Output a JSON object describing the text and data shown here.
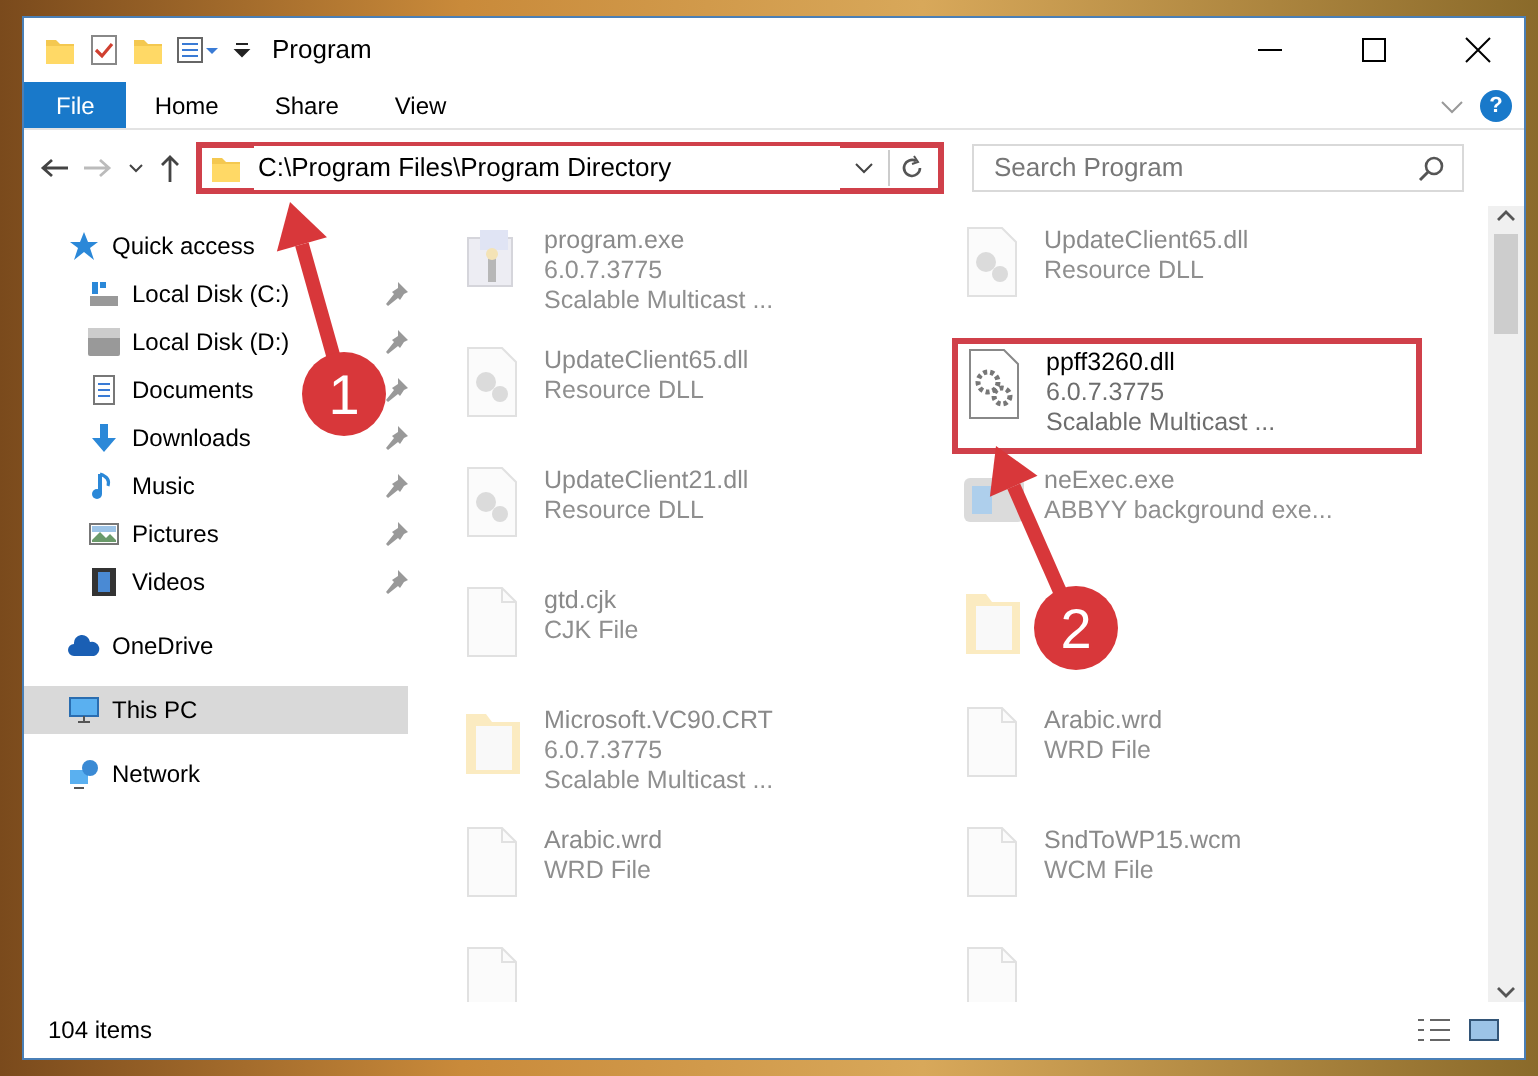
{
  "window": {
    "title": "Program"
  },
  "ribbon_tabs": [
    {
      "label": "File",
      "kind": "file",
      "selected": false
    },
    {
      "label": "Home",
      "kind": "tab",
      "selected": false
    },
    {
      "label": "Share",
      "kind": "tab",
      "selected": false
    },
    {
      "label": "View",
      "kind": "tab",
      "selected": false
    }
  ],
  "help_button": {
    "label": "?"
  },
  "address": {
    "path": "C:\\Program Files\\Program Directory",
    "highlighted": true
  },
  "search": {
    "placeholder": "Search Program"
  },
  "sidebar": [
    {
      "label": "Quick access",
      "kind": "star",
      "selected": false,
      "children": [
        {
          "label": "Local Disk (C:)",
          "kind": "drive-c",
          "pinned": true,
          "selected": false
        },
        {
          "label": "Local Disk (D:)",
          "kind": "drive",
          "pinned": true,
          "selected": false
        },
        {
          "label": "Documents",
          "kind": "documents",
          "pinned": true,
          "selected": false
        },
        {
          "label": "Downloads",
          "kind": "downloads",
          "pinned": true,
          "selected": false
        },
        {
          "label": "Music",
          "kind": "music",
          "pinned": true,
          "selected": false
        },
        {
          "label": "Pictures",
          "kind": "pictures",
          "pinned": true,
          "selected": false
        },
        {
          "label": "Videos",
          "kind": "videos",
          "pinned": true,
          "selected": false
        }
      ]
    },
    {
      "label": "OneDrive",
      "kind": "cloud",
      "selected": false
    },
    {
      "label": "This PC",
      "kind": "pc",
      "selected": true
    },
    {
      "label": "Network",
      "kind": "network",
      "selected": false
    }
  ],
  "files": [
    {
      "name": "program.exe",
      "details": [
        "6.0.7.3775",
        "Scalable Multicast ..."
      ],
      "kind": "exe",
      "dimmed": true,
      "highlighted": false
    },
    {
      "name": "UpdateClient65.dll",
      "details": [
        "Resource DLL"
      ],
      "kind": "dll",
      "dimmed": true,
      "highlighted": false
    },
    {
      "name": "UpdateClient65.dll",
      "details": [
        "Resource DLL"
      ],
      "kind": "dll",
      "dimmed": true,
      "highlighted": false
    },
    {
      "name": "ppff3260.dll",
      "details": [
        "6.0.7.3775",
        "Scalable Multicast ..."
      ],
      "kind": "gear",
      "dimmed": false,
      "highlighted": true
    },
    {
      "name": "UpdateClient21.dll",
      "details": [
        "Resource DLL"
      ],
      "kind": "dll",
      "dimmed": true,
      "highlighted": false
    },
    {
      "name": "neExec.exe",
      "details": [
        "ABBYY background exe..."
      ],
      "kind": "app",
      "dimmed": true,
      "highlighted": false
    },
    {
      "name": "gtd.cjk",
      "details": [
        "CJK File"
      ],
      "kind": "file",
      "dimmed": true,
      "highlighted": false
    },
    {
      "kind": "folder",
      "dimmed": true,
      "highlighted": false
    },
    {
      "name": "Microsoft.VC90.CRT",
      "details": [
        "6.0.7.3775",
        "Scalable Multicast ..."
      ],
      "kind": "folder",
      "dimmed": true,
      "highlighted": false
    },
    {
      "name": "Arabic.wrd",
      "details": [
        "WRD File"
      ],
      "kind": "file",
      "dimmed": true,
      "highlighted": false
    },
    {
      "name": "Arabic.wrd",
      "details": [
        "WRD File"
      ],
      "kind": "file",
      "dimmed": true,
      "highlighted": false
    },
    {
      "name": "SndToWP15.wcm",
      "details": [
        "WCM File"
      ],
      "kind": "file",
      "dimmed": true,
      "highlighted": false
    },
    {
      "kind": "file",
      "dimmed": true,
      "highlighted": false
    },
    {
      "kind": "file",
      "dimmed": true,
      "highlighted": false
    }
  ],
  "callouts": [
    {
      "label": "1"
    },
    {
      "label": "2"
    }
  ],
  "status_bar": {
    "count": "104 items"
  }
}
